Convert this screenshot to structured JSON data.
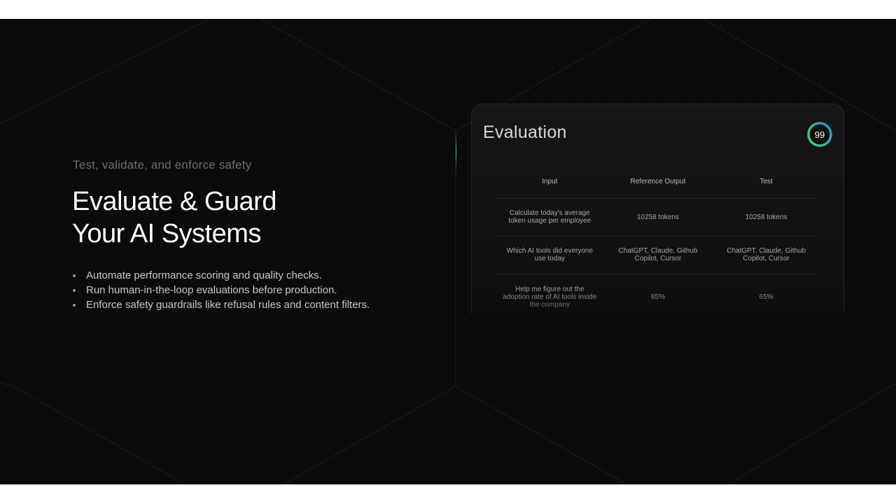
{
  "hero": {
    "eyebrow": "Test, validate, and enforce safety",
    "headline_line1": "Evaluate & Guard",
    "headline_line2": "Your AI Systems",
    "bullets": [
      "Automate performance scoring and quality checks.",
      "Run human-in-the-loop evaluations before production.",
      "Enforce safety guardrails like refusal rules and content filters."
    ]
  },
  "card": {
    "title": "Evaluation",
    "score": "99",
    "score_fraction": 0.99,
    "columns": [
      "Input",
      "Reference Output",
      "Test"
    ],
    "rows": [
      [
        "Calculate today's average token usage per employee",
        "10258 tokens",
        "10258 tokens"
      ],
      [
        "Which AI tools did everyone use today",
        "ChatGPT, Claude, Github Copilot, Cursor",
        "ChatGPT, Claude, Github Copilot, Cursor"
      ],
      [
        "Help me figure out the adoption rate of AI tools inside the company",
        "65%",
        "65%"
      ]
    ]
  },
  "colors": {
    "background": "#0b0b0b",
    "accent_green": "#3fd670",
    "accent_blue": "#2a8fd8"
  }
}
